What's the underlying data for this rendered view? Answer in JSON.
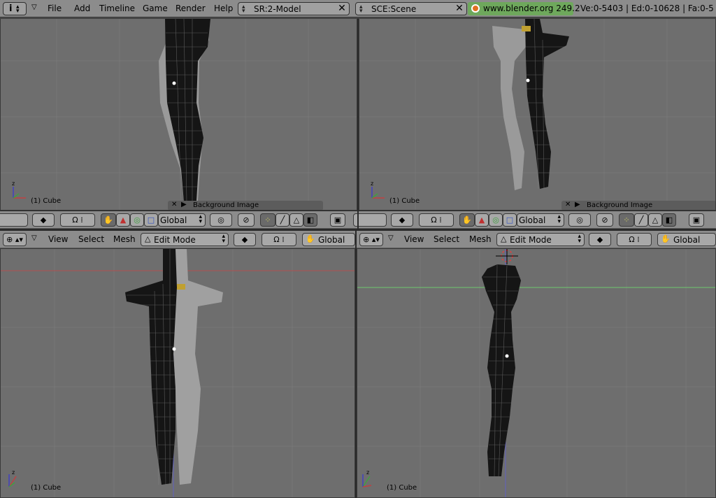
{
  "topbar": {
    "info_icon": "info-icon",
    "menus": [
      "File",
      "Add",
      "Timeline",
      "Game",
      "Render",
      "Help"
    ],
    "screen_field": "SR:2-Model",
    "scene_field": "SCE:Scene",
    "url": "www.blender.org 249.2",
    "stats": "Ve:0-5403 | Ed:0-10628 | Fa:0-5"
  },
  "viewports": {
    "top_left": {
      "object_label": "(1) Cube",
      "bg_panel": "Background Image"
    },
    "top_right": {
      "object_label": "(1) Cube",
      "bg_panel": "Background Image"
    },
    "bottom_left": {
      "object_label": "(1) Cube"
    },
    "bottom_right": {
      "object_label": "(1) Cube"
    }
  },
  "toolbar_top_left": {
    "orientation": "Global"
  },
  "toolbar_top_right": {
    "orientation": "Global"
  },
  "toolbar_bottom_left": {
    "view": "View",
    "select": "Select",
    "mesh": "Mesh",
    "mode": "Edit Mode",
    "orientation": "Global"
  },
  "toolbar_bottom_right": {
    "view": "View",
    "select": "Select",
    "mesh": "Mesh",
    "mode": "Edit Mode",
    "orientation": "Global"
  },
  "colors": {
    "viewport_bg": "#6e6e6e",
    "header_bg": "#8c8c8c",
    "url_bg": "#6ea85c",
    "grid_red": "#b05050",
    "grid_green": "#6ec86e"
  }
}
